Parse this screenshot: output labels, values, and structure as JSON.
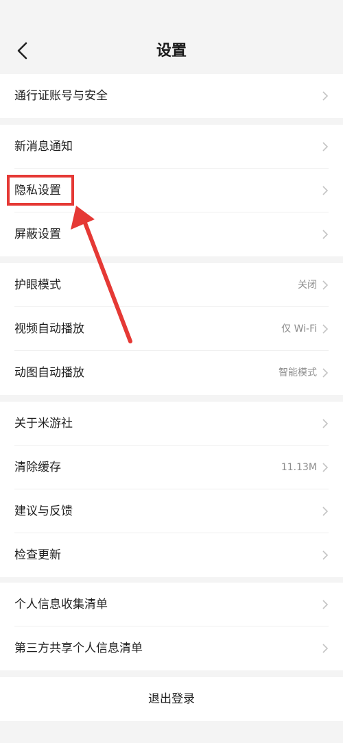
{
  "header": {
    "title": "设置"
  },
  "groups": [
    {
      "items": [
        {
          "label": "通行证账号与安全",
          "value": ""
        }
      ]
    },
    {
      "items": [
        {
          "label": "新消息通知",
          "value": ""
        },
        {
          "label": "隐私设置",
          "value": ""
        },
        {
          "label": "屏蔽设置",
          "value": ""
        }
      ]
    },
    {
      "items": [
        {
          "label": "护眼模式",
          "value": "关闭"
        },
        {
          "label": "视频自动播放",
          "value": "仅 Wi-Fi"
        },
        {
          "label": "动图自动播放",
          "value": "智能模式"
        }
      ]
    },
    {
      "items": [
        {
          "label": "关于米游社",
          "value": ""
        },
        {
          "label": "清除缓存",
          "value": "11.13M"
        },
        {
          "label": "建议与反馈",
          "value": ""
        },
        {
          "label": "检查更新",
          "value": ""
        }
      ]
    },
    {
      "items": [
        {
          "label": "个人信息收集清单",
          "value": ""
        },
        {
          "label": "第三方共享个人信息清单",
          "value": ""
        }
      ]
    }
  ],
  "logout": {
    "label": "退出登录"
  },
  "colors": {
    "annotation": "#e53935",
    "background": "#f4f4f4",
    "card": "#ffffff"
  }
}
